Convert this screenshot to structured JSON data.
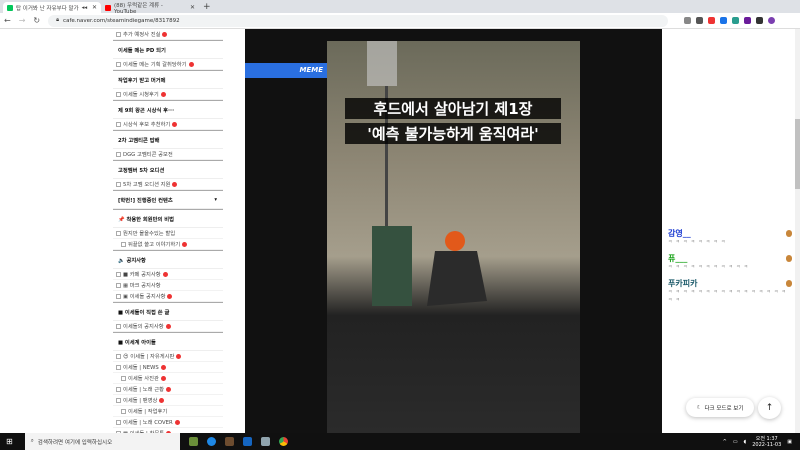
{
  "browser": {
    "tabs": [
      {
        "title": "탑 이거봐 난 자유부다 말가",
        "audio": "◂◂"
      },
      {
        "title": "(88) 우럭같은 계류 - YouTube"
      }
    ],
    "url": "cafe.naver.com/steamindiegame/8317892"
  },
  "sidebar": {
    "items": [
      {
        "label": "추가 예정사 진실",
        "type": "item",
        "new": true
      },
      {
        "label": "이세돌 메는 PD 되기",
        "type": "header"
      },
      {
        "label": "이세돌 메는 기획 갈취당하기",
        "type": "item",
        "new": true
      },
      {
        "label": "작업후기 받고 머거메",
        "type": "header"
      },
      {
        "label": "이세돌 시청후기",
        "type": "item",
        "new": true
      },
      {
        "label": "제 9회 왕곤 시상식 후···",
        "type": "header"
      },
      {
        "label": "시상식 후보 추천하기",
        "type": "item",
        "new": true
      },
      {
        "label": "2차 고멤티콘 밥배",
        "type": "header"
      },
      {
        "label": "DGG 고멤티콘 공모전",
        "type": "item",
        "new": false
      },
      {
        "label": "고정멤버 5차 오디션",
        "type": "header"
      },
      {
        "label": "5차 고멤 오디션 지원",
        "type": "item",
        "new": true
      },
      {
        "label": "[학번!] 진행중인 컨텐츠",
        "type": "header",
        "chevron": "▾"
      },
      {
        "label": "📌 착용한 회원만의 비법",
        "type": "header"
      },
      {
        "label": "뭔지만 몰을수있는 할입",
        "type": "item",
        "new": false
      },
      {
        "label": "뒤끝없 쓸고 이야기하기",
        "type": "sub",
        "new": true
      },
      {
        "label": "🔈 공지사항",
        "type": "header"
      },
      {
        "label": "■ 카페 공지사항",
        "type": "item",
        "new": true
      },
      {
        "label": "▦ 마크 공지사항",
        "type": "item",
        "new": false
      },
      {
        "label": "▣ 이세돌 공지사항",
        "type": "item",
        "new": true
      },
      {
        "label": "■ 이세돌이 직접 쓴 글",
        "type": "header"
      },
      {
        "label": "이세돌의 공지사항",
        "type": "item",
        "new": true
      },
      {
        "label": "■ 이세계 아이돌",
        "type": "header"
      },
      {
        "label": "😍 이세돌 | 자유게시판",
        "type": "item",
        "new": true
      },
      {
        "label": "이세돌 | NEWS",
        "type": "item",
        "new": true
      },
      {
        "label": "이세돌 사진관",
        "type": "sub",
        "new": true
      },
      {
        "label": "이세돌 | 노래 근황",
        "type": "item",
        "new": true
      },
      {
        "label": "이세돌 | 팬영상",
        "type": "item",
        "new": true
      },
      {
        "label": "이세돌 | 작업후기",
        "type": "sub",
        "new": false
      },
      {
        "label": "이세돌 | 노래 COVER",
        "type": "item",
        "new": true
      },
      {
        "label": "▩ 이세돌 | 창문톡",
        "type": "item",
        "new": true
      }
    ]
  },
  "video": {
    "badge": "MEME",
    "caption_line1": "후드에서 살아남기 제1장",
    "caption_line2": "'예측 불가능하게 움직여라'"
  },
  "chat": {
    "messages": [
      {
        "name": "감영__",
        "text": "ㅋ ㅋ ㅋ ㅋ ㅋ ㅋ ㅋ ㅋ",
        "color": "#1a3ad1"
      },
      {
        "name": "퓨___",
        "text": "ㅋ ㅋ ㅋ ㅋ ㅋ ㅋ ㅋ ㅋ ㅋ ㅋ ㅋ",
        "color": "#1aa31a"
      },
      {
        "name": "푸카피카",
        "text": "ㅋ ㅋ ㅋ ㅋ ㅋ ㅋ ㅋ ㅋ ㅋ ㅋ ㅋ ㅋ ㅋ ㅋ ㅋ ㅋ ㅋ ㅋ",
        "color": "#1c5a6a"
      }
    ],
    "dark_mode_label": "다크 모드로 보기"
  },
  "taskbar": {
    "search_placeholder": "검색하려면 여기에 입력하십시오",
    "time": "오전 1:37",
    "date": "2022-11-03"
  }
}
